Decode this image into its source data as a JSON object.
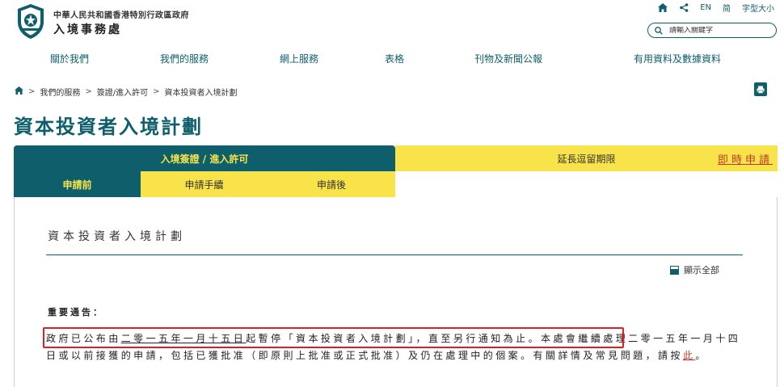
{
  "header": {
    "gov_name": "中華人民共和國香港特別行政區政府",
    "dept_name": "入境事務處",
    "util": {
      "lang_en": "EN",
      "lang_simplified": "简",
      "font_size": "字型大小"
    },
    "search": {
      "placeholder": "請輸入關鍵字"
    }
  },
  "nav": {
    "items": [
      {
        "label": "關於我們"
      },
      {
        "label": "我們的服務"
      },
      {
        "label": "網上服務"
      },
      {
        "label": "表格"
      },
      {
        "label": "刊物及新聞公報"
      },
      {
        "label": "有用資料及數據資料"
      }
    ]
  },
  "breadcrumb": {
    "items": [
      "我們的服務",
      "簽證/進入許可",
      "資本投資者入境計劃"
    ],
    "separator": ">"
  },
  "page_title": "資本投資者入境計劃",
  "tabs": {
    "main_active": "入境簽證 / 進入許可",
    "main_other": "延長逗留期限",
    "apply_link": "即時申請",
    "sub": [
      "申請前",
      "申請手續",
      "申請後"
    ]
  },
  "content": {
    "section_title": "資本投資者入境計劃",
    "show_all": "顯示全部",
    "notice_heading": "重要通告：",
    "notice_p1": "政府已公布由",
    "notice_date": "二零一五年一月十五日",
    "notice_p2": "起暫停「資本投資者入境計劃」，直至另行通知為止。本處會繼續處理二零一五年一月十四日或以前接獲的申請，包括已獲批准（即原則上批准或正式批准）及仍在處理中的個案。有關詳情及常見問題，請按",
    "notice_link": "此",
    "notice_end": "。"
  },
  "colors": {
    "primary": "#0e5f6b",
    "accent": "#f8e44a",
    "link": "#c0392b",
    "highlight": "#e02020"
  }
}
